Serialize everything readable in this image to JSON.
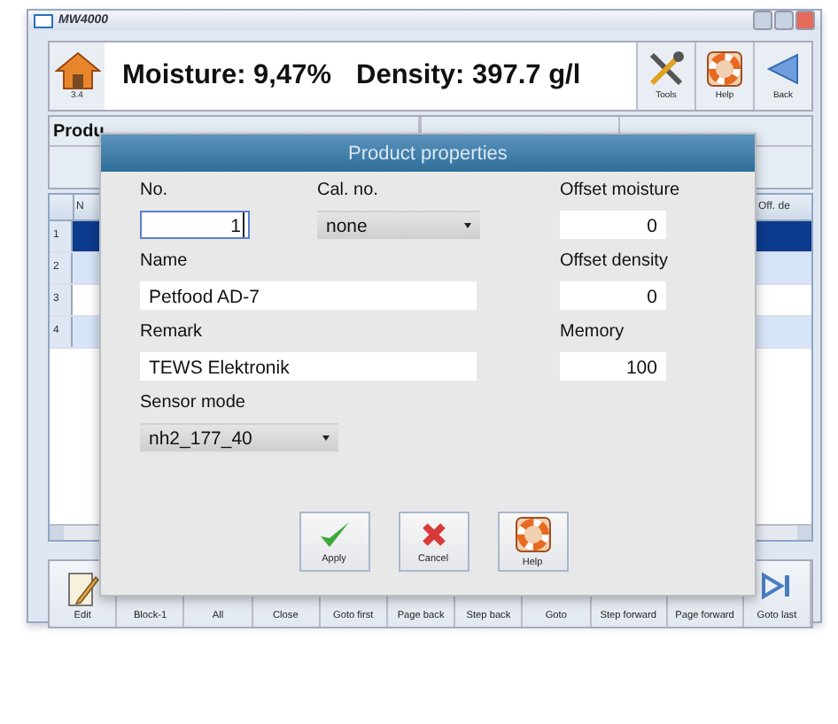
{
  "window": {
    "title": "MW4000"
  },
  "header": {
    "home_label": "3.4",
    "readings": [
      "Moisture: 9,47%",
      "Density: 397.7 g/l"
    ],
    "tool_buttons": [
      {
        "label": "Tools",
        "kind": "tools"
      },
      {
        "label": "Help",
        "kind": "help"
      },
      {
        "label": "Back",
        "kind": "back"
      }
    ]
  },
  "product_settings": {
    "title": "Produ"
  },
  "table": {
    "columns": [
      "N",
      "Off. de"
    ],
    "rows": [
      {
        "number": "1",
        "selected": true
      },
      {
        "number": "2",
        "selected": false
      },
      {
        "number": "3",
        "selected": false
      },
      {
        "number": "4",
        "selected": false
      }
    ]
  },
  "toolbar": [
    {
      "label": "Edit",
      "kind": "edit"
    },
    {
      "label": "Block-1",
      "kind": "plain"
    },
    {
      "label": "All",
      "kind": "plain"
    },
    {
      "label": "Close",
      "kind": "plain"
    },
    {
      "label": "Goto first",
      "kind": "plain"
    },
    {
      "label": "Page back",
      "kind": "plain"
    },
    {
      "label": "Step back",
      "kind": "plain"
    },
    {
      "label": "Goto",
      "kind": "plain"
    },
    {
      "label": "Step forward",
      "kind": "plain"
    },
    {
      "label": "Page forward",
      "kind": "plain"
    },
    {
      "label": "Goto last",
      "kind": "last"
    }
  ],
  "dialog": {
    "title": "Product properties",
    "fields": [
      {
        "label": "No.",
        "value": "1",
        "kind": "number",
        "focused": true
      },
      {
        "label": "Cal. no.",
        "value": "none",
        "kind": "select",
        "focused": false
      },
      {
        "label": "Offset moisture",
        "value": "0",
        "kind": "number",
        "focused": false
      },
      {
        "label": "Name",
        "value": "Petfood AD-7",
        "kind": "text",
        "focused": false
      },
      {
        "label": "Offset density",
        "value": "0",
        "kind": "number",
        "focused": false
      },
      {
        "label": "Remark",
        "value": "TEWS Elektronik",
        "kind": "text",
        "focused": false
      },
      {
        "label": "Memory",
        "value": "100",
        "kind": "number",
        "focused": false
      },
      {
        "label": "Sensor mode",
        "value": "nh2_177_40",
        "kind": "select",
        "focused": false
      }
    ],
    "buttons": [
      {
        "label": "Apply",
        "kind": "apply"
      },
      {
        "label": "Cancel",
        "kind": "cancel"
      },
      {
        "label": "Help",
        "kind": "help"
      }
    ]
  }
}
